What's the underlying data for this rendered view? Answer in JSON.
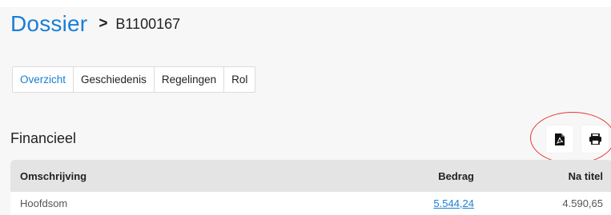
{
  "header": {
    "title": "Dossier",
    "separator": ">",
    "dossier_id": "B1100167"
  },
  "tabs": [
    {
      "label": "Overzicht",
      "active": true
    },
    {
      "label": "Geschiedenis",
      "active": false
    },
    {
      "label": "Regelingen",
      "active": false
    },
    {
      "label": "Rol",
      "active": false
    }
  ],
  "section": {
    "title": "Financieel"
  },
  "actions": {
    "pdf_icon": "pdf-icon",
    "print_icon": "print-icon"
  },
  "table": {
    "columns": [
      "Omschrijving",
      "Bedrag",
      "Na titel"
    ],
    "rows": [
      {
        "omschrijving": "Hoofdsom",
        "bedrag": "5.544,24",
        "na_titel": "4.590,65"
      }
    ]
  },
  "colors": {
    "accent": "#1a7fd4",
    "annotation": "#e53935"
  }
}
